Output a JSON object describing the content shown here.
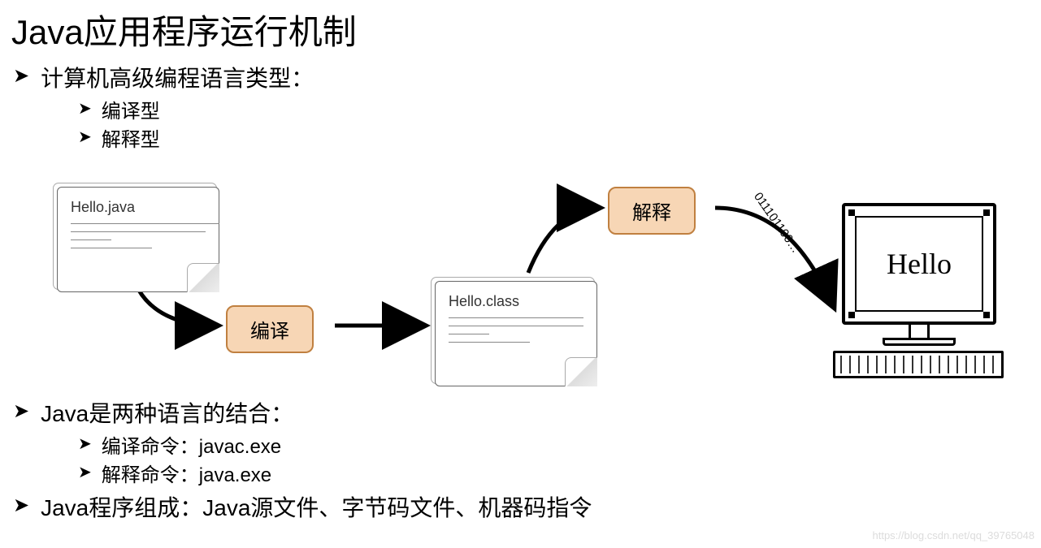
{
  "title": "Java应用程序运行机制",
  "section1": {
    "heading": "计算机高级编程语言类型：",
    "items": [
      "编译型",
      "解释型"
    ]
  },
  "diagram": {
    "file1": "Hello.java",
    "step1": "编译",
    "file2": "Hello.class",
    "step2": "解释",
    "binary": "011101100…",
    "output": "Hello"
  },
  "section2": {
    "heading": "Java是两种语言的结合：",
    "items": [
      "编译命令：javac.exe",
      "解释命令：java.exe"
    ]
  },
  "section3": "Java程序组成：Java源文件、字节码文件、机器码指令",
  "watermark": "https://blog.csdn.net/qq_39765048"
}
